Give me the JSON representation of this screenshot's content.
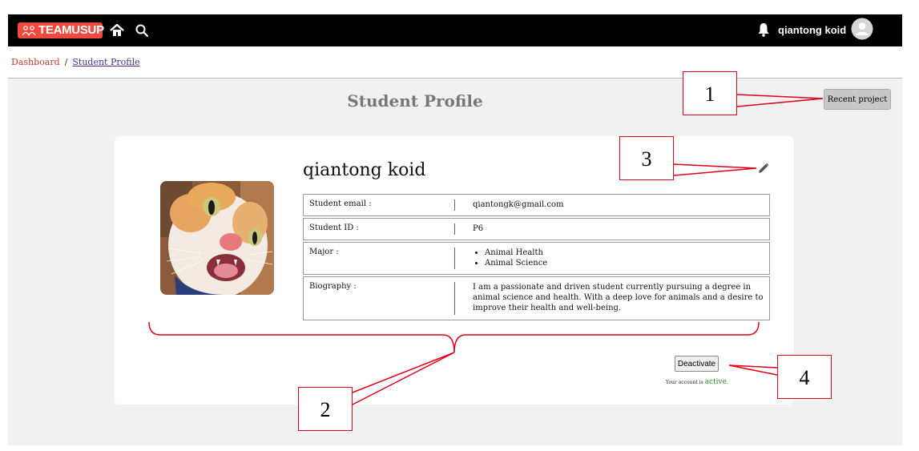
{
  "navbar": {
    "brand": "TEAMUSUP",
    "username": "qiantong koid",
    "icons": [
      "home-icon",
      "search-icon",
      "bell-icon",
      "user-avatar-icon"
    ]
  },
  "breadcrumb": {
    "dashboard": "Dashboard",
    "separator": "/",
    "current": "Student Profile"
  },
  "page": {
    "title": "Student Profile",
    "recent_project_label": "Recent project"
  },
  "profile": {
    "name": "qiantong koid",
    "rows": {
      "email": {
        "label": "Student email :",
        "value": "qiantongk@gmail.com"
      },
      "id": {
        "label": "Student ID :",
        "value": "P6"
      },
      "major": {
        "label": "Major :",
        "values": [
          "Animal Health",
          "Animal Science"
        ]
      },
      "biography": {
        "label": "Biography :",
        "value": "I am a passionate and driven student currently pursuing a degree in animal science and health. With a deep love for animals and a desire to improve their health and well-being."
      }
    },
    "deactivate_label": "Deactivate",
    "status_prefix": "Your account is",
    "status_value": "active",
    "status_suffix": "."
  },
  "annotations": {
    "c1": "1",
    "c2": "2",
    "c3": "3",
    "c4": "4"
  },
  "colors": {
    "brand": "#ef4a3f",
    "annotation": "#e0001a",
    "active": "#2e8b2e"
  }
}
